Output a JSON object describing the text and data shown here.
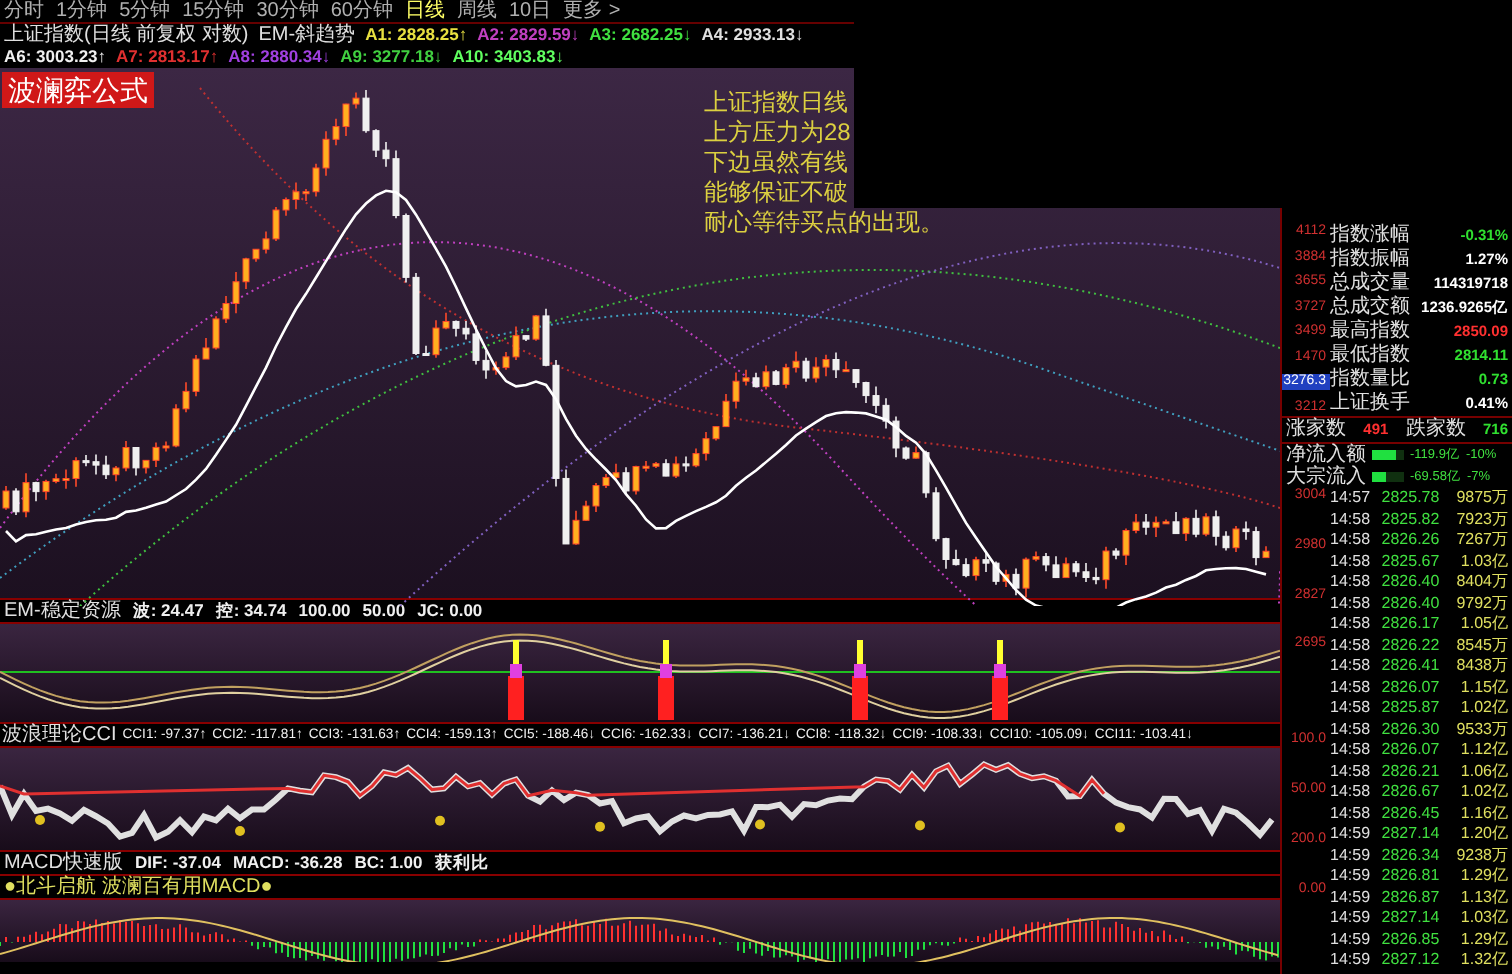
{
  "toolbar": {
    "periods": [
      {
        "label": "分时",
        "selected": false
      },
      {
        "label": "1分钟",
        "selected": false
      },
      {
        "label": "5分钟",
        "selected": false
      },
      {
        "label": "15分钟",
        "selected": false
      },
      {
        "label": "30分钟",
        "selected": false
      },
      {
        "label": "60分钟",
        "selected": false
      },
      {
        "label": "日线",
        "selected": true
      },
      {
        "label": "周线",
        "selected": false
      },
      {
        "label": "10日",
        "selected": false
      },
      {
        "label": "更多 >",
        "selected": false
      }
    ]
  },
  "legend": {
    "title": "上证指数(日线 前复权 对数)",
    "indicator": "EM-斜趋势",
    "values": [
      {
        "text": "A1: 2828.25↑",
        "color": "#e8e040"
      },
      {
        "text": "A2: 2829.59↓",
        "color": "#c040c0"
      },
      {
        "text": "A3: 2682.25↓",
        "color": "#40e040"
      },
      {
        "text": "A4: 2933.13↓",
        "color": "#e0e0e0"
      },
      {
        "text": "A6: 3003.23↑",
        "color": "#f0f0f0"
      },
      {
        "text": "A7: 2813.17↑",
        "color": "#e03030"
      },
      {
        "text": "A8: 2880.34↓",
        "color": "#a040e0"
      },
      {
        "text": "A9: 3277.18↓",
        "color": "#40d040"
      },
      {
        "text": "A10: 3403.83↓",
        "color": "#60ff60"
      }
    ]
  },
  "chart": {
    "badge": "波澜弈公式",
    "annotation": [
      "上证指数日线",
      "上方压力为28",
      "下边虽然有线",
      "能够保证不破",
      "耐心等待买点的出现。"
    ]
  },
  "panels": [
    {
      "kind": "stable",
      "title": "EM-稳定资源",
      "values": [
        {
          "text": "波: 24.47"
        },
        {
          "text": "控: 34.74"
        },
        {
          "text": "100.00"
        },
        {
          "text": "50.00"
        },
        {
          "text": "JC: 0.00"
        }
      ]
    },
    {
      "kind": "cci",
      "title": "波浪理论CCI",
      "values": [
        {
          "text": "CCI1: -97.37↑"
        },
        {
          "text": "CCI2: -117.81↑"
        },
        {
          "text": "CCI3: -131.63↑"
        },
        {
          "text": "CCI4: -159.13↑"
        },
        {
          "text": "CCI5: -188.46↓"
        },
        {
          "text": "CCI6: -162.33↓"
        },
        {
          "text": "CCI7: -136.21↓"
        },
        {
          "text": "CCI8: -118.32↓"
        },
        {
          "text": "CCI9: -108.33↓"
        },
        {
          "text": "CCI10: -105.09↓"
        },
        {
          "text": "CCI11: -103.41↓"
        }
      ]
    },
    {
      "kind": "macd",
      "title": "MACD快速版",
      "subtitle": "●北斗启航 波澜百有用MACD●",
      "values": [
        {
          "text": "DIF: -37.04"
        },
        {
          "text": "MACD: -36.28"
        },
        {
          "text": "BC: 1.00"
        },
        {
          "text": "获利比"
        }
      ]
    }
  ],
  "axis": {
    "main": [
      {
        "text": "4112",
        "highlight": false
      },
      {
        "text": "3884",
        "highlight": false
      },
      {
        "text": "3655",
        "highlight": false
      },
      {
        "text": "3727",
        "highlight": false
      },
      {
        "text": "3499",
        "highlight": false
      },
      {
        "text": "1470",
        "highlight": false
      },
      {
        "text": "3276.3",
        "highlight": true
      },
      {
        "text": "3212",
        "highlight": false
      },
      {
        "text": "3004",
        "highlight": false
      },
      {
        "text": "2980",
        "highlight": false
      },
      {
        "text": "2827",
        "highlight": false
      },
      {
        "text": "2695",
        "highlight": false
      }
    ],
    "sub": [
      {
        "text": "100.0",
        "highlight": false
      },
      {
        "text": "50.00",
        "highlight": false
      },
      {
        "text": "200.0",
        "highlight": false
      },
      {
        "text": "0.00",
        "highlight": false
      }
    ]
  },
  "stats": [
    {
      "label": "指数涨幅",
      "value": "-0.31%",
      "color": "#30e030"
    },
    {
      "label": "指数振幅",
      "value": "1.27%",
      "color": "#ffffff"
    },
    {
      "label": "总成交量",
      "value": "114319718",
      "color": "#ffffff"
    },
    {
      "label": "总成交额",
      "value": "1236.9265亿",
      "color": "#ffffff"
    },
    {
      "label": "最高指数",
      "value": "2850.09",
      "color": "#ff3030"
    },
    {
      "label": "最低指数",
      "value": "2814.11",
      "color": "#30e030"
    },
    {
      "label": "指数量比",
      "value": "0.73",
      "color": "#30e030"
    },
    {
      "label": "上证换手",
      "value": "0.41%",
      "color": "#ffffff"
    }
  ],
  "breadth": {
    "up_label": "涨家数",
    "up": "491",
    "down_label": "跌家数",
    "down": "716"
  },
  "flows": [
    {
      "label": "净流入额",
      "level": 0.75,
      "amount": "-119.9亿",
      "percent": "-10%"
    },
    {
      "label": "大宗流入",
      "level": 0.45,
      "amount": "-69.58亿",
      "percent": "-7%"
    }
  ],
  "ticks": [
    {
      "time": "14:57",
      "price": "2825.78",
      "volume": "9875万"
    },
    {
      "time": "14:58",
      "price": "2825.82",
      "volume": "7923万"
    },
    {
      "time": "14:58",
      "price": "2826.26",
      "volume": "7267万"
    },
    {
      "time": "14:58",
      "price": "2825.67",
      "volume": "1.03亿"
    },
    {
      "time": "14:58",
      "price": "2826.40",
      "volume": "8404万"
    },
    {
      "time": "14:58",
      "price": "2826.40",
      "volume": "9792万"
    },
    {
      "time": "14:58",
      "price": "2826.17",
      "volume": "1.05亿"
    },
    {
      "time": "14:58",
      "price": "2826.22",
      "volume": "8545万"
    },
    {
      "time": "14:58",
      "price": "2826.41",
      "volume": "8438万"
    },
    {
      "time": "14:58",
      "price": "2826.07",
      "volume": "1.15亿"
    },
    {
      "time": "14:58",
      "price": "2825.87",
      "volume": "1.02亿"
    },
    {
      "time": "14:58",
      "price": "2826.30",
      "volume": "9533万"
    },
    {
      "time": "14:58",
      "price": "2826.07",
      "volume": "1.12亿"
    },
    {
      "time": "14:58",
      "price": "2826.21",
      "volume": "1.06亿"
    },
    {
      "time": "14:58",
      "price": "2826.67",
      "volume": "1.02亿"
    },
    {
      "time": "14:58",
      "price": "2826.45",
      "volume": "1.16亿"
    },
    {
      "time": "14:59",
      "price": "2827.14",
      "volume": "1.20亿"
    },
    {
      "time": "14:59",
      "price": "2826.34",
      "volume": "9238万"
    },
    {
      "time": "14:59",
      "price": "2826.81",
      "volume": "1.29亿"
    },
    {
      "time": "14:59",
      "price": "2826.87",
      "volume": "1.13亿"
    },
    {
      "time": "14:59",
      "price": "2827.14",
      "volume": "1.03亿"
    },
    {
      "time": "14:59",
      "price": "2826.85",
      "volume": "1.29亿"
    },
    {
      "time": "14:59",
      "price": "2827.12",
      "volume": "1.32亿"
    }
  ]
}
